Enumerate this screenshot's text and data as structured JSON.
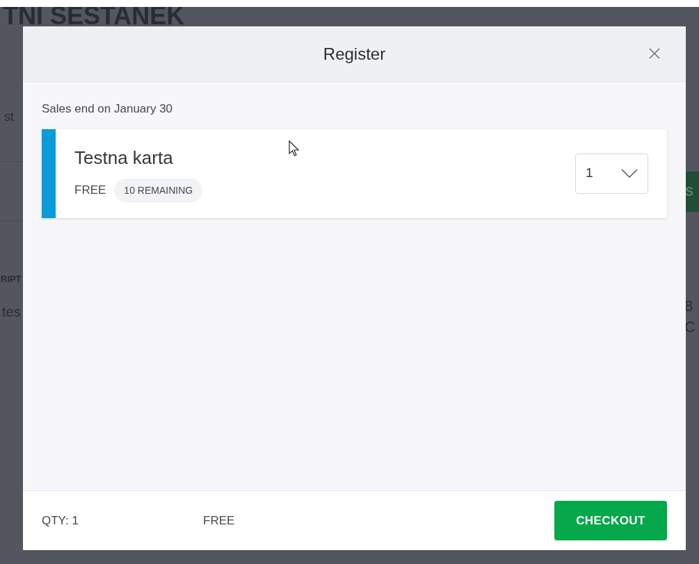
{
  "background_page": {
    "heading": "TNI SESTANEK",
    "texts": [
      {
        "kind": "left",
        "text": "st"
      },
      {
        "kind": "left-bold",
        "text": "RIPT"
      },
      {
        "kind": "left",
        "text": "tes"
      },
      {
        "kind": "right-button",
        "text": "S"
      },
      {
        "kind": "right",
        "text": "8"
      },
      {
        "kind": "right",
        "text": "C"
      }
    ]
  },
  "modal": {
    "title": "Register",
    "sales_note": "Sales end on January 30",
    "tickets": [
      {
        "name": "Testna karta",
        "price": "FREE",
        "remaining": "10 REMAINING",
        "quantity": "1",
        "color": "#0a9bdb"
      }
    ],
    "footer": {
      "qty": "QTY: 1",
      "total": "FREE",
      "checkout": "CHECKOUT"
    }
  }
}
